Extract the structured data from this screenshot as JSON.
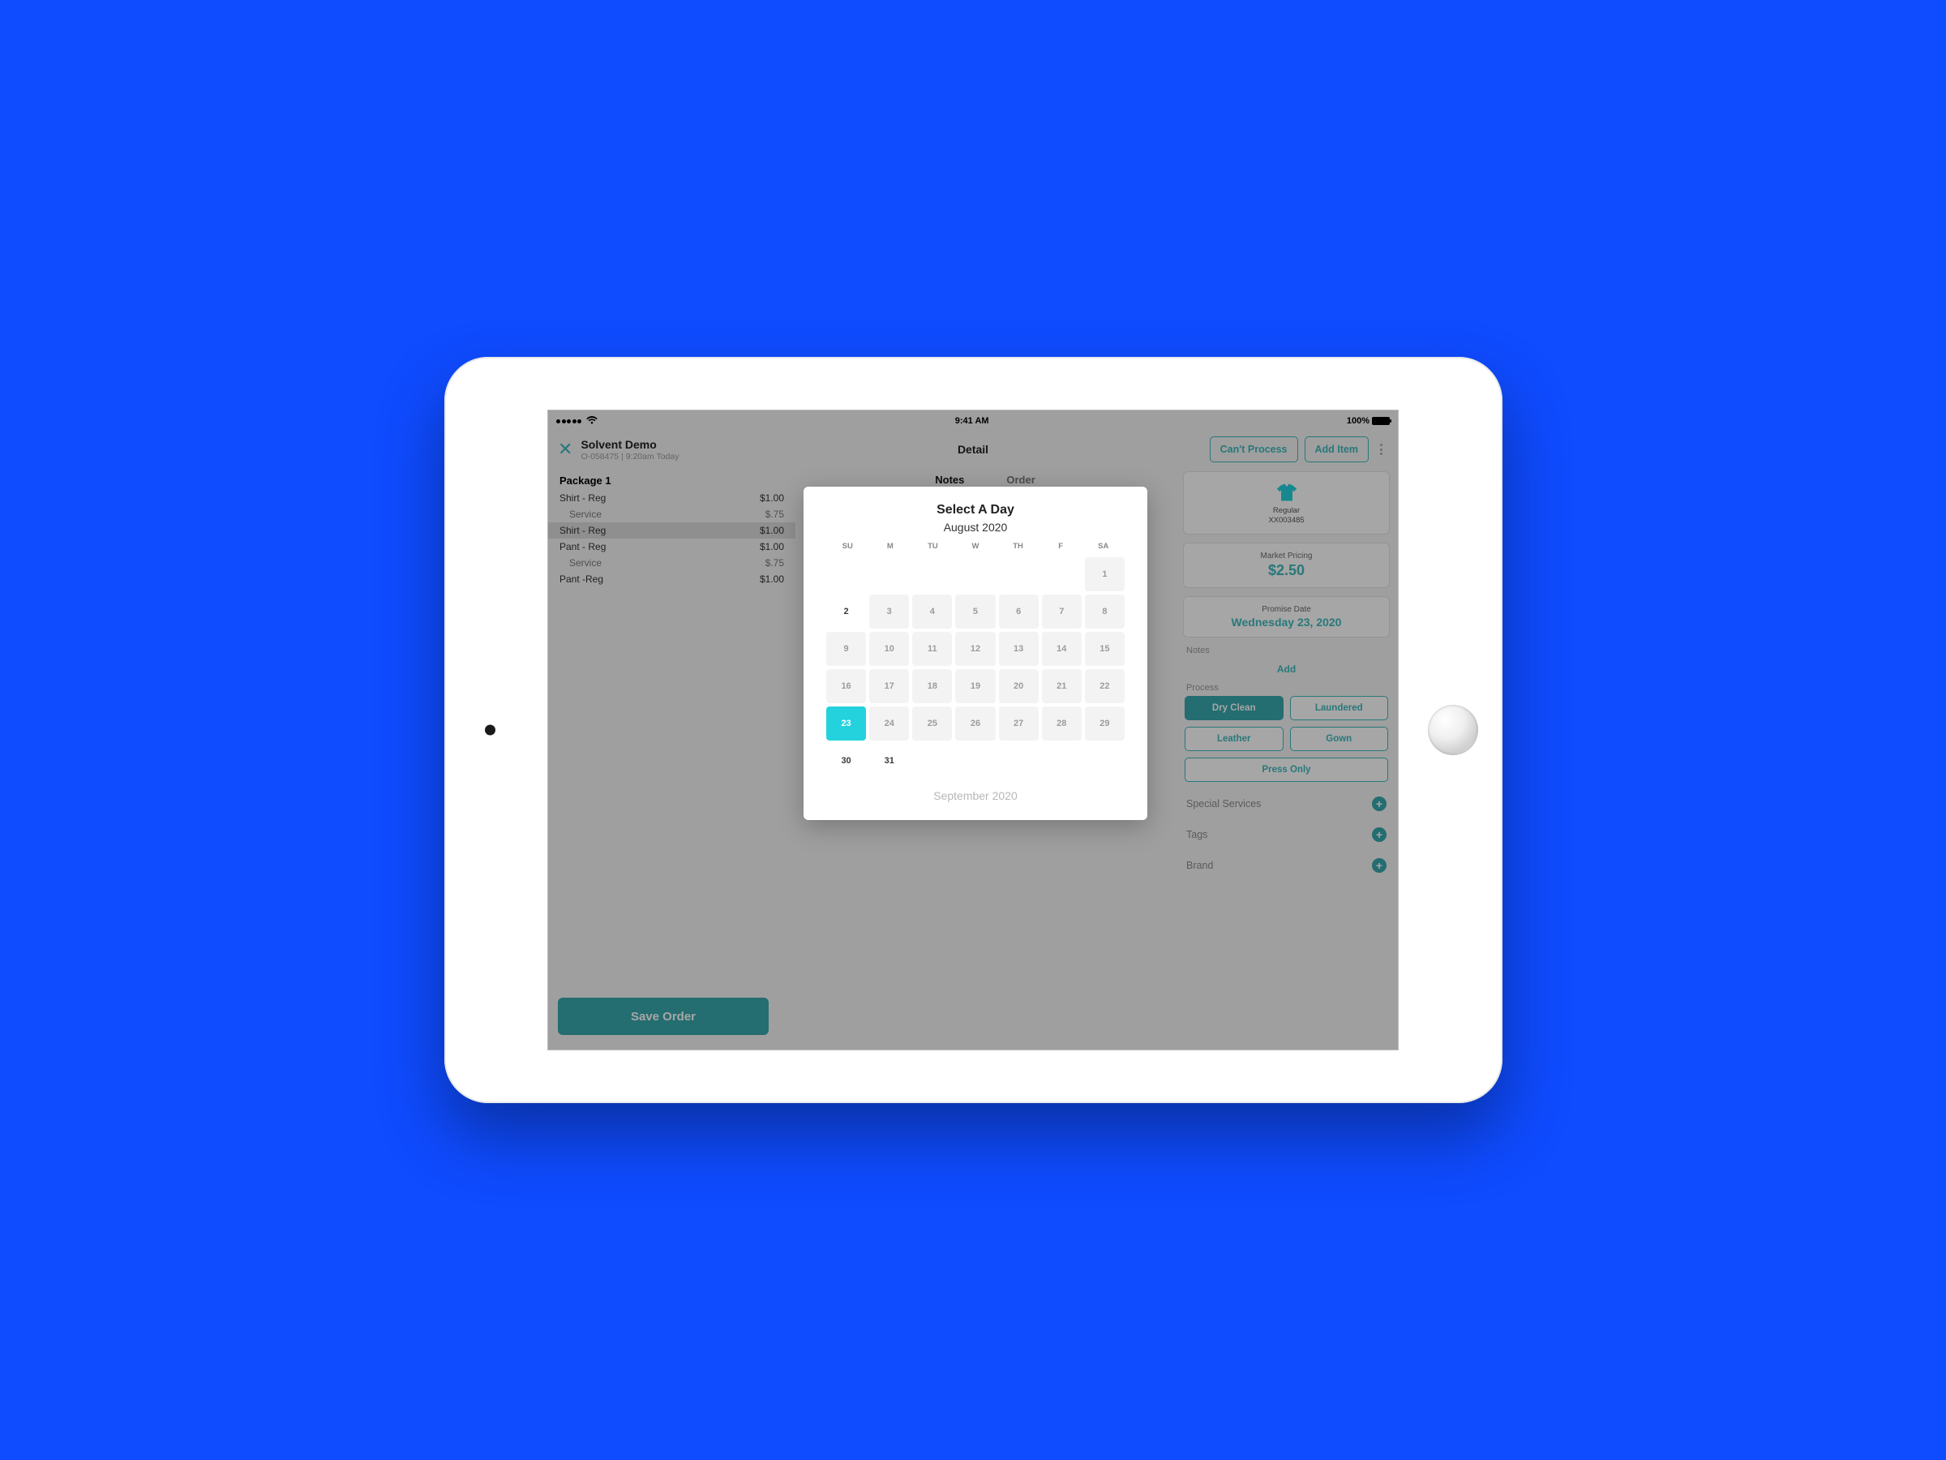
{
  "statusbar": {
    "time": "9:41 AM",
    "battery": "100%"
  },
  "header": {
    "title": "Solvent Demo",
    "subtitle": "O-058475  |  9:20am Today",
    "section": "Detail",
    "cant_process": "Can't Process",
    "add_item": "Add Item"
  },
  "package": {
    "title": "Package 1",
    "lines": [
      {
        "label": "Shirt - Reg",
        "price": "$1.00",
        "sub": false,
        "hl": false
      },
      {
        "label": "Service",
        "price": "$.75",
        "sub": true,
        "hl": false
      },
      {
        "label": "Shirt - Reg",
        "price": "$1.00",
        "sub": false,
        "hl": true
      },
      {
        "label": "Pant - Reg",
        "price": "$1.00",
        "sub": false,
        "hl": false
      },
      {
        "label": "Service",
        "price": "$.75",
        "sub": true,
        "hl": false
      },
      {
        "label": "Pant -Reg",
        "price": "$1.00",
        "sub": false,
        "hl": false
      }
    ]
  },
  "save_label": "Save Order",
  "tabs": {
    "notes": "Notes",
    "order": "Order"
  },
  "item": {
    "type": "Regular",
    "sku": "XX003485"
  },
  "pricing": {
    "label": "Market Pricing",
    "value": "$2.50"
  },
  "promise": {
    "label": "Promise Date",
    "value": "Wednesday 23, 2020"
  },
  "notes": {
    "label": "Notes",
    "add": "Add"
  },
  "process": {
    "label": "Process",
    "opts": [
      "Dry Clean",
      "Laundered",
      "Leather",
      "Gown",
      "Press Only"
    ],
    "selected": "Dry Clean"
  },
  "accordions": [
    "Special Services",
    "Tags",
    "Brand"
  ],
  "picker": {
    "title": "Select A Day",
    "month": "August 2020",
    "dow": [
      "SU",
      "M",
      "TU",
      "W",
      "TH",
      "F",
      "SA"
    ],
    "weeks": [
      [
        "",
        "",
        "",
        "",
        "",
        "",
        "1"
      ],
      [
        "2",
        "3",
        "4",
        "5",
        "6",
        "7",
        "8"
      ],
      [
        "9",
        "10",
        "11",
        "12",
        "13",
        "14",
        "15"
      ],
      [
        "16",
        "17",
        "18",
        "19",
        "20",
        "21",
        "22"
      ],
      [
        "23",
        "24",
        "25",
        "26",
        "27",
        "28",
        "29"
      ],
      [
        "30",
        "31",
        "",
        "",
        "",
        "",
        ""
      ]
    ],
    "fill": [
      [
        6
      ],
      [
        1,
        2,
        3,
        4,
        5,
        6
      ],
      [
        0,
        1,
        2,
        3,
        4,
        5,
        6
      ],
      [
        0,
        1,
        2,
        3,
        4,
        5,
        6
      ],
      [
        0,
        1,
        2,
        3,
        4,
        5,
        6
      ],
      [
        0,
        1,
        2
      ]
    ],
    "open": [
      [],
      [],
      [],
      [],
      [],
      [
        0,
        1
      ]
    ],
    "selected": "23",
    "next": "September 2020"
  }
}
